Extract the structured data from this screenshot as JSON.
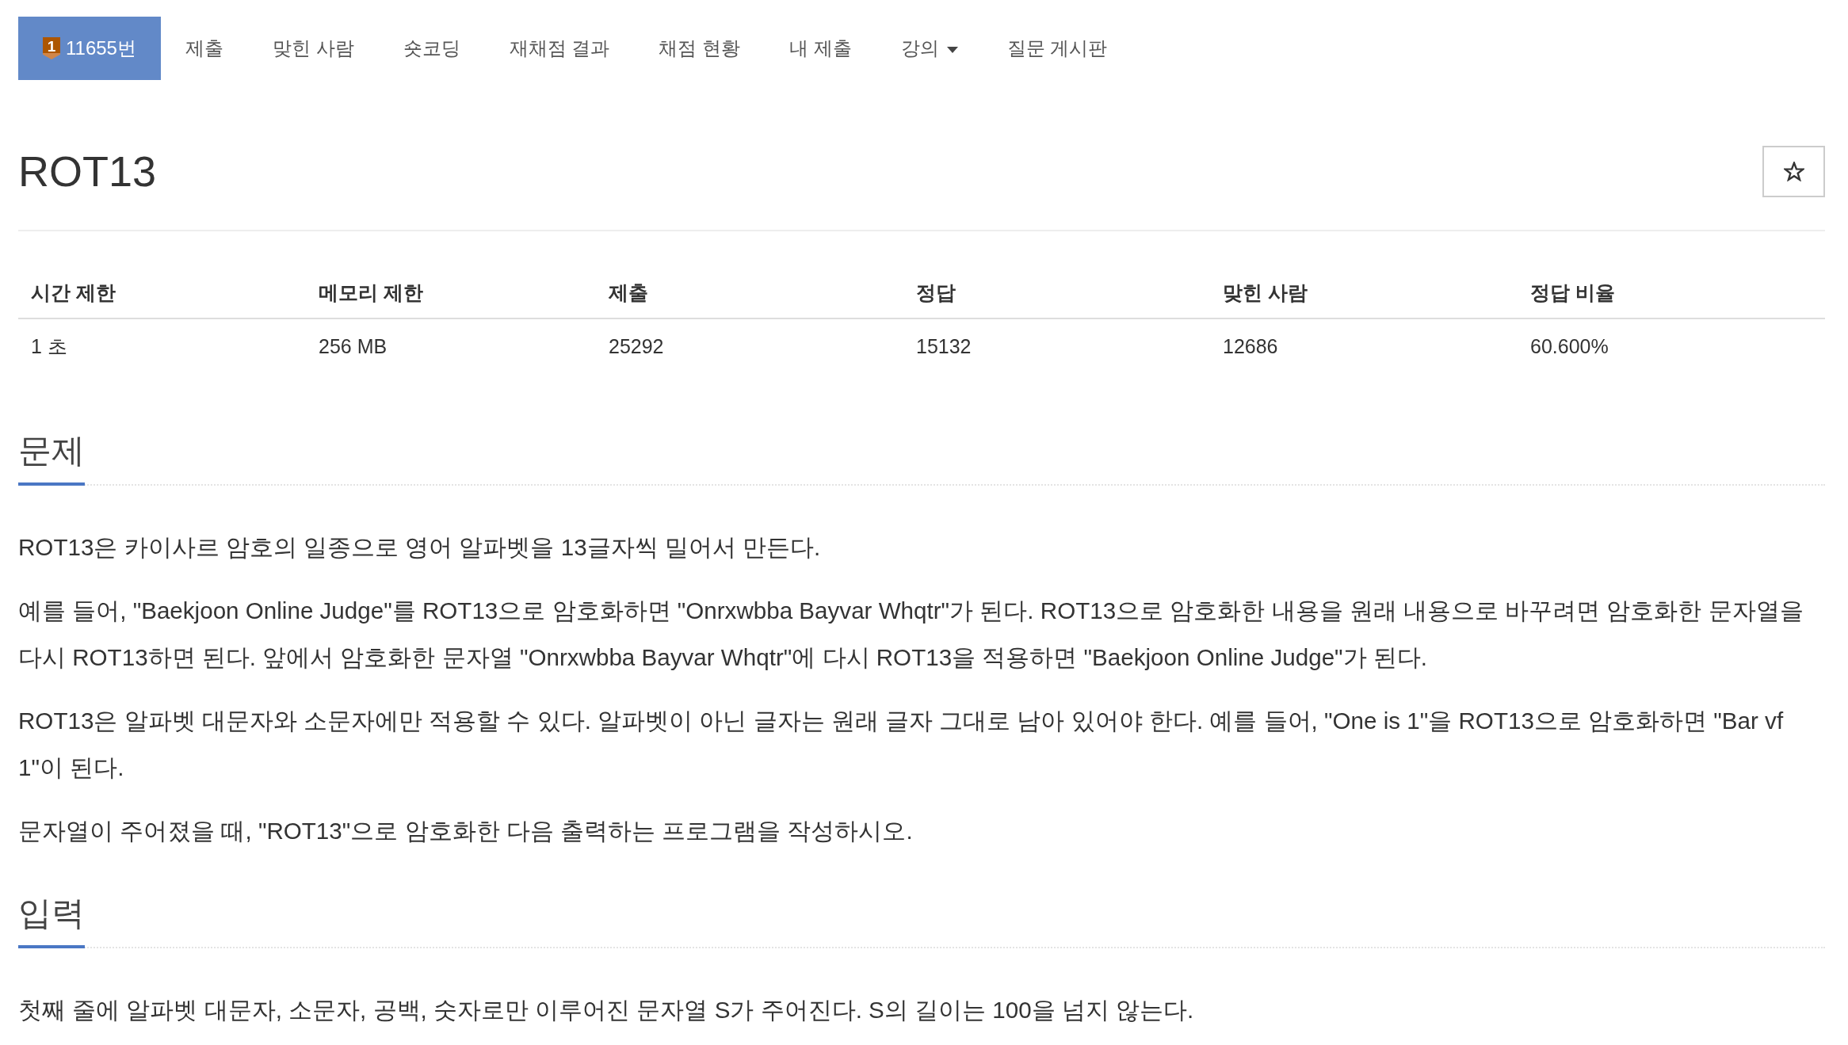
{
  "nav": {
    "tabs": [
      {
        "kind": "problem",
        "tier": "1",
        "label": "11655번",
        "selected": true
      },
      {
        "kind": "link",
        "label": "제출",
        "selected": false
      },
      {
        "kind": "link",
        "label": "맞힌 사람",
        "selected": false
      },
      {
        "kind": "link",
        "label": "숏코딩",
        "selected": false
      },
      {
        "kind": "link",
        "label": "재채점 결과",
        "selected": false
      },
      {
        "kind": "link",
        "label": "채점 현황",
        "selected": false
      },
      {
        "kind": "link",
        "label": "내 제출",
        "selected": false
      },
      {
        "kind": "dropdown",
        "label": "강의",
        "selected": false
      },
      {
        "kind": "link",
        "label": "질문 게시판",
        "selected": false
      }
    ]
  },
  "problem": {
    "title": "ROT13",
    "starred": false
  },
  "info_table": {
    "columns": [
      "시간 제한",
      "메모리 제한",
      "제출",
      "정답",
      "맞힌 사람",
      "정답 비율"
    ],
    "rows": [
      [
        "1 초",
        "256 MB",
        "25292",
        "15132",
        "12686",
        "60.600%"
      ]
    ]
  },
  "sections": [
    {
      "title": "문제",
      "paragraphs": [
        "ROT13은 카이사르 암호의 일종으로 영어 알파벳을 13글자씩 밀어서 만든다.",
        "예를 들어, \"Baekjoon Online Judge\"를 ROT13으로 암호화하면 \"Onrxwbba Bayvar Whqtr\"가 된다. ROT13으로 암호화한 내용을 원래 내용으로 바꾸려면 암호화한 문자열을 다시 ROT13하면 된다. 앞에서 암호화한 문자열 \"Onrxwbba Bayvar Whqtr\"에 다시 ROT13을 적용하면 \"Baekjoon Online Judge\"가 된다.",
        "ROT13은 알파벳 대문자와 소문자에만 적용할 수 있다. 알파벳이 아닌 글자는 원래 글자 그대로 남아 있어야 한다. 예를 들어, \"One is 1\"을 ROT13으로 암호화하면 \"Bar vf 1\"이 된다.",
        "문자열이 주어졌을 때, \"ROT13\"으로 암호화한 다음 출력하는 프로그램을 작성하시오."
      ]
    },
    {
      "title": "입력",
      "paragraphs": [
        "첫째 줄에 알파벳 대문자, 소문자, 공백, 숫자로만 이루어진 문자열 S가 주어진다. S의 길이는 100을 넘지 않는다."
      ]
    }
  ]
}
